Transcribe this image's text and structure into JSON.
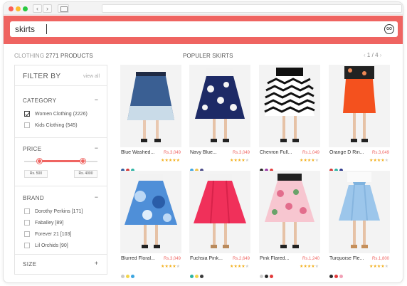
{
  "search": {
    "query": "skirts",
    "go_label": "GO"
  },
  "results": {
    "category": "CLOTHING",
    "count": "2771",
    "unit": "PRODUCTS"
  },
  "section": {
    "title": "POPULER SKIRTS"
  },
  "pager": {
    "prev": "‹",
    "current": "1",
    "sep": "/",
    "total": "4",
    "next": "›"
  },
  "filter": {
    "title": "FILTER BY",
    "view_all": "view all",
    "category": {
      "title": "CATEGORY",
      "toggle": "−",
      "options": [
        {
          "label": "Women Clothing (2226)",
          "checked": true
        },
        {
          "label": "Kids Clothing (545)",
          "checked": false
        }
      ]
    },
    "price": {
      "title": "PRICE",
      "toggle": "−",
      "min_label": "Rs. 500",
      "max_label": "Rs. 4000",
      "range_low": 0.21,
      "range_high": 0.8
    },
    "brand": {
      "title": "BRAND",
      "toggle": "−",
      "options": [
        {
          "label": "Dorothy Perkins [171]",
          "checked": false
        },
        {
          "label": "Faballey [89]",
          "checked": false
        },
        {
          "label": "Forever 21 [103]",
          "checked": false
        },
        {
          "label": "Lil Orchids [90]",
          "checked": false
        }
      ]
    },
    "size": {
      "title": "SIZE",
      "toggle": "+"
    }
  },
  "products": [
    {
      "name": "Blue Washed...",
      "price": "Rs.3,049",
      "rating": 5,
      "swatches": [
        "#2f5a9c",
        "#d33a3a",
        "#2bb3a3"
      ],
      "art": "denim"
    },
    {
      "name": "Navy Blue...",
      "price": "Rs.3,049",
      "rating": 4,
      "swatches": [
        "#3da6e0",
        "#f0c24a",
        "#4a4a88"
      ],
      "art": "navyfloral"
    },
    {
      "name": "Chevron Full...",
      "price": "Rs.1,049",
      "rating": 4,
      "swatches": [
        "#222222",
        "#9b3fa8",
        "#e23b3b"
      ],
      "art": "chevron"
    },
    {
      "name": "Orange D Rin...",
      "price": "Rs.3,049",
      "rating": 4,
      "swatches": [
        "#d33a3a",
        "#2bb3a3",
        "#2f3a8c"
      ],
      "art": "orange"
    },
    {
      "name": "Blurred Floral...",
      "price": "Rs.3,049",
      "rating": 4,
      "swatches": [
        "#c9c9c9",
        "#f2d54a",
        "#3da6e0"
      ],
      "art": "bluefloral"
    },
    {
      "name": "Fuchsia Pink...",
      "price": "Rs.2,649",
      "rating": 4,
      "swatches": [
        "#2bb3a3",
        "#f2d54a",
        "#3a3a3a"
      ],
      "art": "pink"
    },
    {
      "name": "Pink Flared...",
      "price": "Rs.1,240",
      "rating": 4,
      "swatches": [
        "#cfcfcf",
        "#2a2a2a",
        "#e23b3b"
      ],
      "art": "pinkfloral"
    },
    {
      "name": "Turquoise Fle...",
      "price": "Rs.1,800",
      "rating": 4,
      "swatches": [
        "#2a2a2a",
        "#e23b3b",
        "#f2a0b6"
      ],
      "art": "turquoise"
    }
  ],
  "colors": {
    "accent": "#ef6461",
    "star": "#f2b01e"
  }
}
